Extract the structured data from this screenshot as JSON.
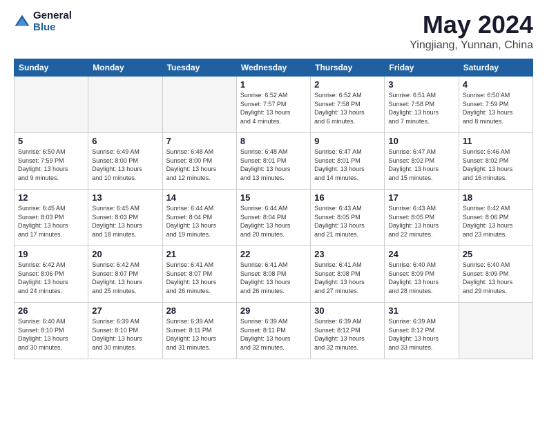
{
  "header": {
    "logo_general": "General",
    "logo_blue": "Blue",
    "title": "May 2024",
    "subtitle": "Yingjiang, Yunnan, China"
  },
  "weekdays": [
    "Sunday",
    "Monday",
    "Tuesday",
    "Wednesday",
    "Thursday",
    "Friday",
    "Saturday"
  ],
  "weeks": [
    [
      {
        "day": "",
        "info": ""
      },
      {
        "day": "",
        "info": ""
      },
      {
        "day": "",
        "info": ""
      },
      {
        "day": "1",
        "info": "Sunrise: 6:52 AM\nSunset: 7:57 PM\nDaylight: 13 hours\nand 4 minutes."
      },
      {
        "day": "2",
        "info": "Sunrise: 6:52 AM\nSunset: 7:58 PM\nDaylight: 13 hours\nand 6 minutes."
      },
      {
        "day": "3",
        "info": "Sunrise: 6:51 AM\nSunset: 7:58 PM\nDaylight: 13 hours\nand 7 minutes."
      },
      {
        "day": "4",
        "info": "Sunrise: 6:50 AM\nSunset: 7:59 PM\nDaylight: 13 hours\nand 8 minutes."
      }
    ],
    [
      {
        "day": "5",
        "info": "Sunrise: 6:50 AM\nSunset: 7:59 PM\nDaylight: 13 hours\nand 9 minutes."
      },
      {
        "day": "6",
        "info": "Sunrise: 6:49 AM\nSunset: 8:00 PM\nDaylight: 13 hours\nand 10 minutes."
      },
      {
        "day": "7",
        "info": "Sunrise: 6:48 AM\nSunset: 8:00 PM\nDaylight: 13 hours\nand 12 minutes."
      },
      {
        "day": "8",
        "info": "Sunrise: 6:48 AM\nSunset: 8:01 PM\nDaylight: 13 hours\nand 13 minutes."
      },
      {
        "day": "9",
        "info": "Sunrise: 6:47 AM\nSunset: 8:01 PM\nDaylight: 13 hours\nand 14 minutes."
      },
      {
        "day": "10",
        "info": "Sunrise: 6:47 AM\nSunset: 8:02 PM\nDaylight: 13 hours\nand 15 minutes."
      },
      {
        "day": "11",
        "info": "Sunrise: 6:46 AM\nSunset: 8:02 PM\nDaylight: 13 hours\nand 16 minutes."
      }
    ],
    [
      {
        "day": "12",
        "info": "Sunrise: 6:45 AM\nSunset: 8:03 PM\nDaylight: 13 hours\nand 17 minutes."
      },
      {
        "day": "13",
        "info": "Sunrise: 6:45 AM\nSunset: 8:03 PM\nDaylight: 13 hours\nand 18 minutes."
      },
      {
        "day": "14",
        "info": "Sunrise: 6:44 AM\nSunset: 8:04 PM\nDaylight: 13 hours\nand 19 minutes."
      },
      {
        "day": "15",
        "info": "Sunrise: 6:44 AM\nSunset: 8:04 PM\nDaylight: 13 hours\nand 20 minutes."
      },
      {
        "day": "16",
        "info": "Sunrise: 6:43 AM\nSunset: 8:05 PM\nDaylight: 13 hours\nand 21 minutes."
      },
      {
        "day": "17",
        "info": "Sunrise: 6:43 AM\nSunset: 8:05 PM\nDaylight: 13 hours\nand 22 minutes."
      },
      {
        "day": "18",
        "info": "Sunrise: 6:42 AM\nSunset: 8:06 PM\nDaylight: 13 hours\nand 23 minutes."
      }
    ],
    [
      {
        "day": "19",
        "info": "Sunrise: 6:42 AM\nSunset: 8:06 PM\nDaylight: 13 hours\nand 24 minutes."
      },
      {
        "day": "20",
        "info": "Sunrise: 6:42 AM\nSunset: 8:07 PM\nDaylight: 13 hours\nand 25 minutes."
      },
      {
        "day": "21",
        "info": "Sunrise: 6:41 AM\nSunset: 8:07 PM\nDaylight: 13 hours\nand 26 minutes."
      },
      {
        "day": "22",
        "info": "Sunrise: 6:41 AM\nSunset: 8:08 PM\nDaylight: 13 hours\nand 26 minutes."
      },
      {
        "day": "23",
        "info": "Sunrise: 6:41 AM\nSunset: 8:08 PM\nDaylight: 13 hours\nand 27 minutes."
      },
      {
        "day": "24",
        "info": "Sunrise: 6:40 AM\nSunset: 8:09 PM\nDaylight: 13 hours\nand 28 minutes."
      },
      {
        "day": "25",
        "info": "Sunrise: 6:40 AM\nSunset: 8:09 PM\nDaylight: 13 hours\nand 29 minutes."
      }
    ],
    [
      {
        "day": "26",
        "info": "Sunrise: 6:40 AM\nSunset: 8:10 PM\nDaylight: 13 hours\nand 30 minutes."
      },
      {
        "day": "27",
        "info": "Sunrise: 6:39 AM\nSunset: 8:10 PM\nDaylight: 13 hours\nand 30 minutes."
      },
      {
        "day": "28",
        "info": "Sunrise: 6:39 AM\nSunset: 8:11 PM\nDaylight: 13 hours\nand 31 minutes."
      },
      {
        "day": "29",
        "info": "Sunrise: 6:39 AM\nSunset: 8:11 PM\nDaylight: 13 hours\nand 32 minutes."
      },
      {
        "day": "30",
        "info": "Sunrise: 6:39 AM\nSunset: 8:12 PM\nDaylight: 13 hours\nand 32 minutes."
      },
      {
        "day": "31",
        "info": "Sunrise: 6:39 AM\nSunset: 8:12 PM\nDaylight: 13 hours\nand 33 minutes."
      },
      {
        "day": "",
        "info": ""
      }
    ]
  ]
}
